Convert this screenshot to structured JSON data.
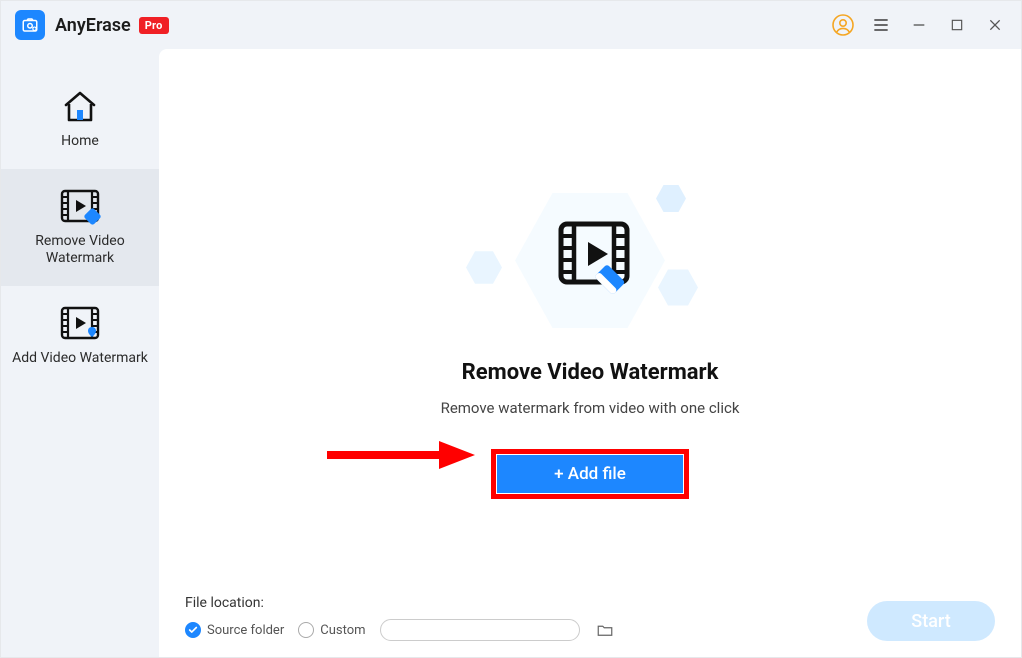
{
  "app": {
    "name": "AnyErase",
    "badge": "Pro"
  },
  "titlebar": {
    "user_icon": "user-circle",
    "menu_icon": "menu",
    "minimize_icon": "minimize",
    "maximize_icon": "maximize",
    "close_icon": "close"
  },
  "sidebar": {
    "items": [
      {
        "label": "Home",
        "active": false
      },
      {
        "label": "Remove Video Watermark",
        "active": true
      },
      {
        "label": "Add Video Watermark",
        "active": false
      }
    ]
  },
  "hero": {
    "title": "Remove Video Watermark",
    "subtitle": "Remove watermark from video with one click",
    "add_file_label": "+ Add file"
  },
  "footer": {
    "file_location_label": "File location:",
    "source_folder_label": "Source folder",
    "custom_label": "Custom",
    "start_label": "Start",
    "source_selected": true
  },
  "annotation": {
    "arrow": "highlight-arrow"
  }
}
